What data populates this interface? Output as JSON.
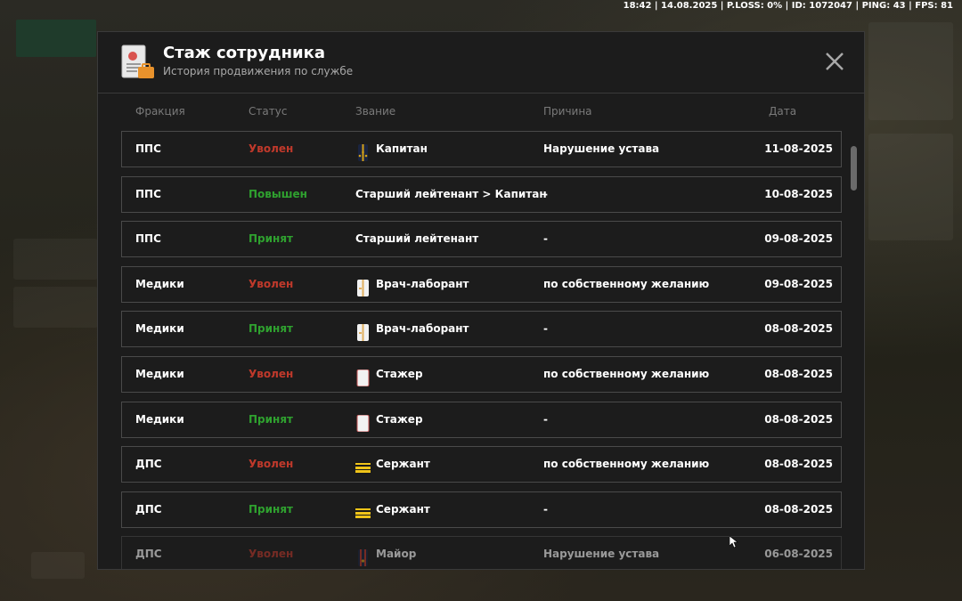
{
  "hud": {
    "status_line": "18:42 | 14.08.2025 | P.LOSS: 0% | ID: 1072047 | PING: 43 | FPS: 81"
  },
  "modal": {
    "title": "Стаж сотрудника",
    "subtitle": "История продвижения по службе"
  },
  "columns": {
    "faction": "Фракция",
    "status": "Статус",
    "rank": "Звание",
    "reason": "Причина",
    "date": "Дата"
  },
  "rows": [
    {
      "faction": "ППС",
      "status": "Уволен",
      "status_type": "fired",
      "rank": "Капитан",
      "rank_icon": "police-shoulder-icon",
      "reason": "Нарушение устава",
      "date": "11-08-2025"
    },
    {
      "faction": "ППС",
      "status": "Повышен",
      "status_type": "ok",
      "rank": "Старший лейтенант > Капитан",
      "rank_icon": "",
      "reason": "-",
      "date": "10-08-2025"
    },
    {
      "faction": "ППС",
      "status": "Принят",
      "status_type": "ok",
      "rank": "Старший лейтенант",
      "rank_icon": "",
      "reason": "-",
      "date": "09-08-2025"
    },
    {
      "faction": "Медики",
      "status": "Уволен",
      "status_type": "fired",
      "rank": "Врач-лаборант",
      "rank_icon": "medic-coat-icon",
      "reason": "по собственному желанию",
      "date": "09-08-2025"
    },
    {
      "faction": "Медики",
      "status": "Принят",
      "status_type": "ok",
      "rank": "Врач-лаборант",
      "rank_icon": "medic-coat-icon",
      "reason": "-",
      "date": "08-08-2025"
    },
    {
      "faction": "Медики",
      "status": "Уволен",
      "status_type": "fired",
      "rank": "Стажер",
      "rank_icon": "intern-coat-icon",
      "reason": "по собственному желанию",
      "date": "08-08-2025"
    },
    {
      "faction": "Медики",
      "status": "Принят",
      "status_type": "ok",
      "rank": "Стажер",
      "rank_icon": "intern-coat-icon",
      "reason": "-",
      "date": "08-08-2025"
    },
    {
      "faction": "ДПС",
      "status": "Уволен",
      "status_type": "fired",
      "rank": "Сержант",
      "rank_icon": "sergeant-stripes-icon",
      "reason": "по собственному желанию",
      "date": "08-08-2025"
    },
    {
      "faction": "ДПС",
      "status": "Принят",
      "status_type": "ok",
      "rank": "Сержант",
      "rank_icon": "sergeant-stripes-icon",
      "reason": "-",
      "date": "08-08-2025"
    },
    {
      "faction": "ДПС",
      "status": "Уволен",
      "status_type": "fired",
      "rank": "Майор",
      "rank_icon": "major-shoulder-icon",
      "reason": "Нарушение устава",
      "date": "06-08-2025"
    }
  ],
  "colors": {
    "fired": "#c0392b",
    "ok": "#2fa12f",
    "row_border": "#4a4a4a",
    "modal_bg": "#1c1c1c"
  }
}
